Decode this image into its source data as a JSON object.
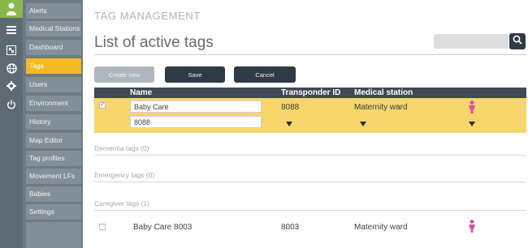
{
  "nav": {
    "items": [
      {
        "label": "Alerts",
        "active": false
      },
      {
        "label": "Medical Stations",
        "active": false
      },
      {
        "label": "Dashboard",
        "active": false
      },
      {
        "label": "Tags",
        "active": true
      },
      {
        "label": "Users",
        "active": false
      },
      {
        "label": "Environment",
        "active": false
      },
      {
        "label": "History",
        "active": false
      },
      {
        "label": "Map Editor",
        "active": false
      },
      {
        "label": "Tag profiles",
        "active": false
      },
      {
        "label": "Movement LFs",
        "active": false
      },
      {
        "label": "Babies",
        "active": false
      },
      {
        "label": "Settings",
        "active": false
      }
    ]
  },
  "header": {
    "section": "TAG MANAGEMENT",
    "title": "List of active tags"
  },
  "search": {
    "value": "",
    "placeholder": ""
  },
  "toolbar": {
    "create_label": "Create new",
    "save_label": "Save",
    "cancel_label": "Cancel"
  },
  "table": {
    "headers": {
      "name": "Name",
      "transponder": "Transponder ID",
      "station": "Medical station"
    }
  },
  "edit_row": {
    "name_value": "Baby Care",
    "id_value": "8088",
    "transponder": "8088",
    "station": "Maternity ward",
    "checked_mark": "✓"
  },
  "groups": {
    "dementia": "Dementia tags (0)",
    "emergency": "Emergency tags (0)",
    "caregiver": "Caregiver tags (1)"
  },
  "caregiver_row": {
    "name": "Baby Care 8003",
    "transponder": "8003",
    "station": "Maternity ward"
  },
  "colors": {
    "accent": "#f5b926",
    "dark": "#2f3b45",
    "person_icon": "#d64fa3"
  },
  "icons": {
    "sidebar": [
      "person-icon",
      "menu-icon",
      "map-icon",
      "globe-icon",
      "gear-icon",
      "power-icon"
    ],
    "search": "search-icon",
    "row": "person-icon"
  }
}
